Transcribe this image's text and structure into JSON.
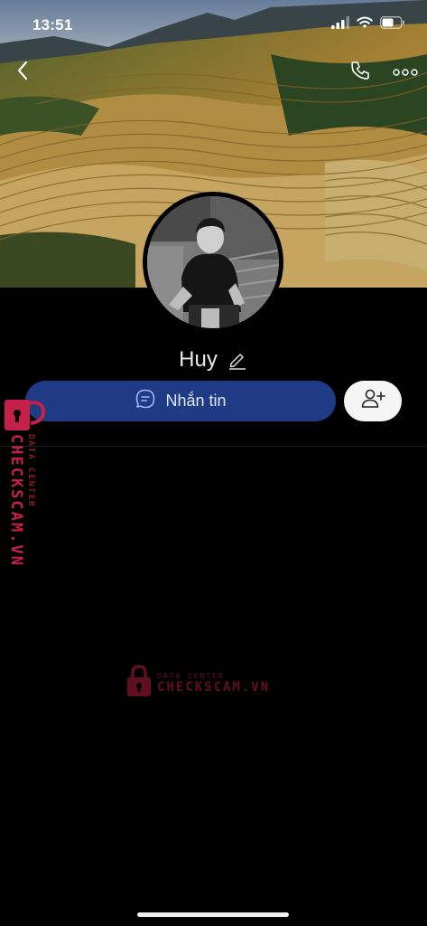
{
  "status_bar": {
    "time": "13:51"
  },
  "profile": {
    "name": "Huy"
  },
  "actions": {
    "message_label": "Nhắn tin"
  },
  "watermark": {
    "brand": "CHECKSCAM.VN",
    "sub": "DATA CENTER"
  },
  "icons": {
    "back": "chevron-left-icon",
    "call": "phone-icon",
    "more": "more-dots-icon",
    "edit": "pencil-icon",
    "chat": "chat-bubble-icon",
    "add_friend": "add-user-icon",
    "lock": "padlock-icon"
  },
  "colors": {
    "message_button": "#1f3b86",
    "watermark": "#c4204a",
    "background": "#000000"
  }
}
